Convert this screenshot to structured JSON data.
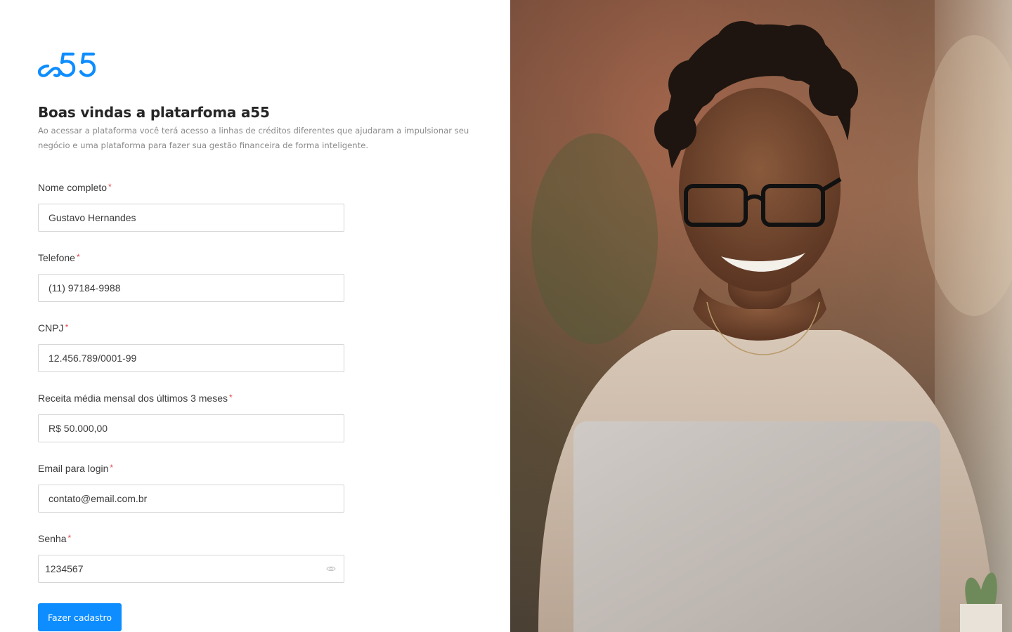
{
  "brand": {
    "logo_text": "a55",
    "accent": "#0d8dff"
  },
  "header": {
    "title": "Boas vindas a platarfoma a55",
    "subtitle": "Ao acessar a plataforma você terá acesso a linhas de créditos diferentes que ajudaram a impulsionar seu negócio e uma plataforma para fazer sua gestão financeira de forma inteligente."
  },
  "form": {
    "fields": [
      {
        "label": "Nome completo",
        "value": "Gustavo Hernandes"
      },
      {
        "label": "Telefone",
        "value": "(11) 97184-9988"
      },
      {
        "label": "CNPJ",
        "value": "12.456.789/0001-99"
      },
      {
        "label": "Receita média mensal dos últimos 3 meses",
        "value": "R$ 50.000,00"
      },
      {
        "label": "Email para login",
        "value": "contato@email.com.br"
      },
      {
        "label": "Senha",
        "value": "1234567",
        "icon": "eye-icon"
      }
    ],
    "required_mark": "*",
    "submit_label": "Fazer cadastro"
  }
}
